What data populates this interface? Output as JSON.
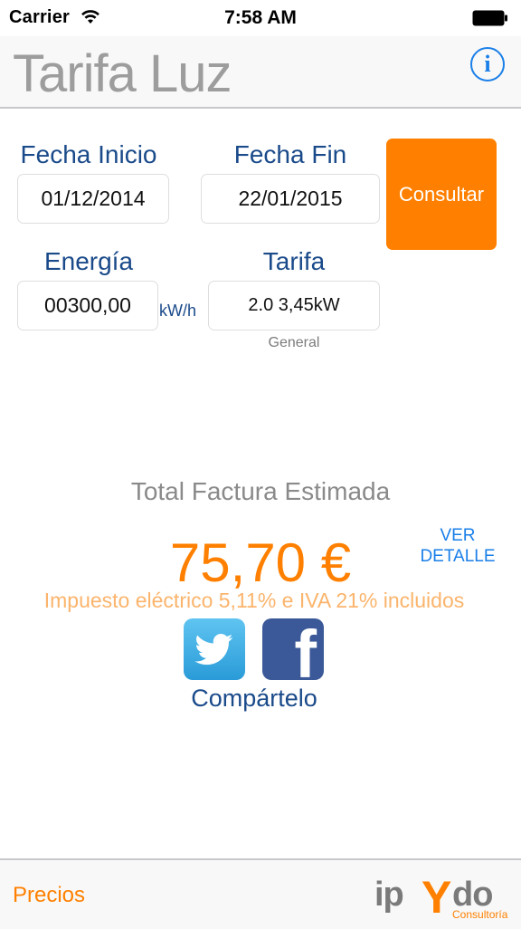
{
  "status_bar": {
    "carrier": "Carrier",
    "time": "7:58 AM"
  },
  "nav": {
    "title": "Tarifa Luz",
    "info_label": "i"
  },
  "form": {
    "fecha_inicio_label": "Fecha Inicio",
    "fecha_inicio_value": "01/12/2014",
    "fecha_fin_label": "Fecha Fin",
    "fecha_fin_value": "22/01/2015",
    "consultar_label": "Consultar",
    "energia_label": "Energía",
    "energia_value": "00300,00",
    "energia_unit": "kW/h",
    "tarifa_label": "Tarifa",
    "tarifa_value": "2.0 3,45kW",
    "tarifa_sub": "General"
  },
  "result": {
    "total_label": "Total Factura Estimada",
    "amount": "75,70 €",
    "taxes_note": "Impuesto eléctrico 5,11% e IVA 21% incluidos",
    "ver_detalle_line1": "VER",
    "ver_detalle_line2": "DETALLE"
  },
  "share": {
    "label": "Compártelo",
    "twitter_icon": "twitter-icon",
    "facebook_icon": "facebook-icon"
  },
  "tab_bar": {
    "precios_label": "Precios",
    "logo_text": "ipYdo",
    "logo_sub": "Consultoría"
  },
  "colors": {
    "accent_orange": "#ff8000",
    "label_blue": "#1a4a8a",
    "link_blue": "#1a7fe8",
    "twitter": "#2a9bd8",
    "facebook": "#3b5998"
  }
}
